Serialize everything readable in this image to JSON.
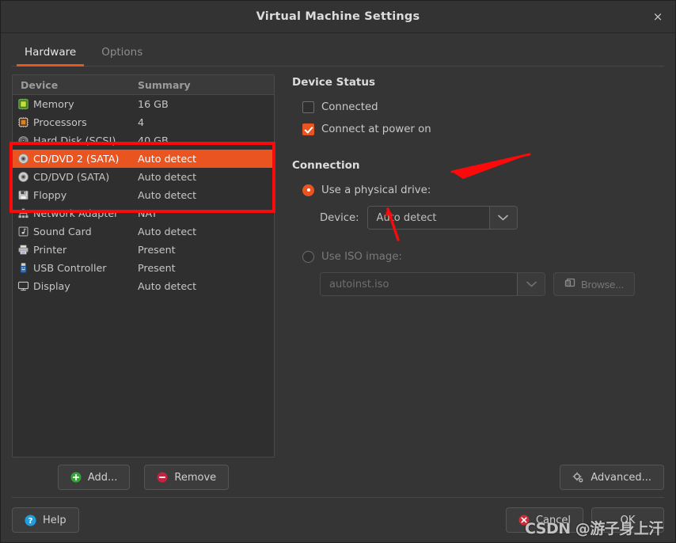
{
  "window": {
    "title": "Virtual Machine Settings",
    "close_icon": "close-icon",
    "close_label": "×"
  },
  "tabs": [
    {
      "label": "Hardware",
      "active": true
    },
    {
      "label": "Options",
      "active": false
    }
  ],
  "device_table": {
    "columns": [
      "Device",
      "Summary"
    ],
    "rows": [
      {
        "icon": "memory-chip-icon",
        "device": "Memory",
        "summary": "16 GB",
        "selected": false
      },
      {
        "icon": "processor-chip-icon",
        "device": "Processors",
        "summary": "4",
        "selected": false
      },
      {
        "icon": "hard-disk-icon",
        "device": "Hard Disk (SCSI)",
        "summary": "40 GB",
        "selected": false
      },
      {
        "icon": "cd-dvd-icon",
        "device": "CD/DVD 2 (SATA)",
        "summary": "Auto detect",
        "selected": true
      },
      {
        "icon": "cd-dvd-icon",
        "device": "CD/DVD (SATA)",
        "summary": "Auto detect",
        "selected": false
      },
      {
        "icon": "floppy-icon",
        "device": "Floppy",
        "summary": "Auto detect",
        "selected": false
      },
      {
        "icon": "network-adapter-icon",
        "device": "Network Adapter",
        "summary": "NAT",
        "selected": false
      },
      {
        "icon": "sound-card-icon",
        "device": "Sound Card",
        "summary": "Auto detect",
        "selected": false
      },
      {
        "icon": "printer-icon",
        "device": "Printer",
        "summary": "Present",
        "selected": false
      },
      {
        "icon": "usb-controller-icon",
        "device": "USB Controller",
        "summary": "Present",
        "selected": false
      },
      {
        "icon": "display-icon",
        "device": "Display",
        "summary": "Auto detect",
        "selected": false
      }
    ]
  },
  "left_buttons": {
    "add_label": "Add...",
    "add_icon": "plus-circle-icon",
    "remove_label": "Remove",
    "remove_icon": "minus-circle-icon",
    "advanced_label": "Advanced...",
    "advanced_icon": "gear-icon"
  },
  "device_status": {
    "title": "Device Status",
    "connected_label": "Connected",
    "connected_checked": false,
    "power_on_label": "Connect at power on",
    "power_on_checked": true
  },
  "connection": {
    "title": "Connection",
    "physical_drive_label": "Use a physical drive:",
    "physical_drive_selected": true,
    "device_label": "Device:",
    "device_value": "Auto detect",
    "iso_label": "Use ISO image:",
    "iso_selected": false,
    "iso_value": "autoinst.iso",
    "browse_label": "Browse...",
    "browse_icon": "folder-icon"
  },
  "footer": {
    "help_label": "Help",
    "help_icon": "question-circle-icon",
    "cancel_label": "Cancel",
    "cancel_icon": "cancel-icon",
    "ok_label": "OK"
  },
  "watermark": {
    "text": "CSDN @游子身上汗"
  },
  "colors": {
    "accent": "#e95420",
    "annotation": "#fa0a0a",
    "window_bg": "#353535",
    "list_bg": "#2f2f2f",
    "text": "#c6c6c6"
  }
}
